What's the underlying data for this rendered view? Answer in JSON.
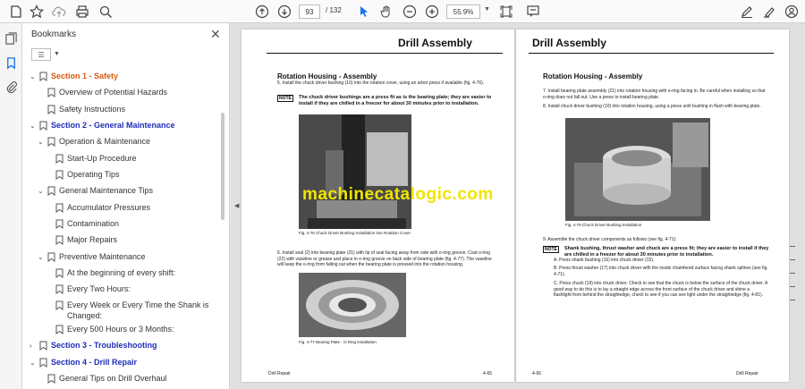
{
  "toolbar": {
    "page_current": "93",
    "page_total": "/ 132",
    "zoom": "55.9%"
  },
  "panel": {
    "title": "Bookmarks",
    "close": "✕",
    "options": "☰"
  },
  "bookmarks": [
    {
      "label": "Section 1 - Safety"
    },
    {
      "label": "Overview of Potential Hazards"
    },
    {
      "label": "Safety Instructions"
    },
    {
      "label": "Section 2 - General Maintenance"
    },
    {
      "label": "Operation & Maintenance"
    },
    {
      "label": "Start-Up Procedure"
    },
    {
      "label": "Operating Tips"
    },
    {
      "label": "General Maintenance Tips"
    },
    {
      "label": "Accumulator Pressures"
    },
    {
      "label": "Contamination"
    },
    {
      "label": "Major Repairs"
    },
    {
      "label": "Preventive Maintenance"
    },
    {
      "label": "At the beginning of every shift:"
    },
    {
      "label": "Every Two Hours:"
    },
    {
      "label": "Every Week or Every Time the Shank is"
    },
    {
      "label": "Changed:"
    },
    {
      "label": "Every 500 Hours or 3 Months:"
    },
    {
      "label": "Section 3 - Troubleshooting"
    },
    {
      "label": "Section 4 - Drill Repair"
    },
    {
      "label": "General Tips on Drill Overhaul"
    }
  ],
  "left_page": {
    "header": "Drill Assembly",
    "subheading": "Rotation Housing - Assembly",
    "step5": "5.   Install the chuck driver bushing (10) into the rotation cover, using an arbor press if available (fig. 4-76).",
    "note_tag": "NOTE",
    "note": "The chuck driver bushings are a press fit as is the bearing plate; they are easier to install if they are chilled in a freezer for about 30 minutes prior to installation.",
    "fig1_caption": "Fig. 4-76  Chuck Driver Bushing Installation into Rotation Cover",
    "step6": "6.   Install seal (2) into bearing plate (21) with lip of seal facing away from side with o-ring groove. Coat o-ring (22) with vaseline or grease and place in o-ring groove on back side of bearing plate (fig. 4-77). The vaseline will keep the o-ring from falling out when the bearing plate is pressed into the rotation housing.",
    "fig2_caption": "Fig. 4-77  Bearing Plate - O Ring Installation",
    "footer_left": "Drill Repair",
    "footer_right": "4-65"
  },
  "right_page": {
    "header": "Drill Assembly",
    "subheading": "Rotation Housing - Assembly",
    "step7": "7.   Install bearing plate assembly (21) into rotation housing with o-ring facing in. Be careful when installing so that o-ring does not fall out. Use a press to install bearing plate.",
    "step8": "8.   Install chuck driver bushing (10) into rotation housing, using a press until bushing in flush with bearing plate.",
    "fig_caption": "Fig. 4-78  Chuck Driver Bushing Installation",
    "step9": "9.   Assemble the chuck driver components as follows (see fig. 4-71):",
    "note_tag": "NOTE",
    "note": "Shank bushing, thrust washer and chuck are a press fit; they are easier to install if they are chilled in a freezer for about 30 minutes prior to installation.",
    "stepA": "A.   Press shank bushing (16) into chuck driver (15).",
    "stepB": "B.   Press thrust washer (17) into chuck driver with the inside chamfered surface facing shank splines (see fig. 4-71).",
    "stepC": "C.   Press chuck (19) into chuck driver. Check to see that the chuck is below the surface of the chuck driver. A good way to do this is to lay a straight edge across the front surface of the chuck driver and shine a flashlight from behind the straightedge, check to see if you can see light under the straightedge (fig. 4-81).",
    "footer_left": "4-66",
    "footer_right": "Drill Repair"
  },
  "watermark": "machinecatalogic.com",
  "colors": {
    "section_blue": "#1f2db8",
    "section_orange": "#d85a10",
    "watermark": "#f0e600"
  }
}
